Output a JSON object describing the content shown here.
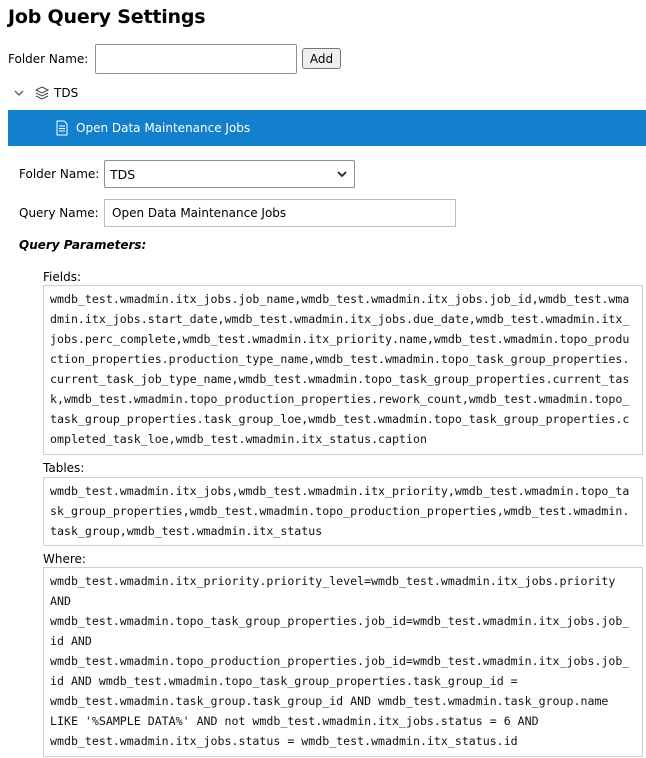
{
  "page": {
    "title": "Job Query Settings"
  },
  "add_folder": {
    "label": "Folder Name:",
    "value": "",
    "button_label": "Add"
  },
  "tree": {
    "folder_name": "TDS",
    "selected_item": "Open Data Maintenance Jobs"
  },
  "form": {
    "folder_label": "Folder Name:",
    "folder_value": "TDS",
    "query_name_label": "Query Name:",
    "query_name_value": "Open Data Maintenance Jobs",
    "params_heading": "Query Parameters:",
    "fields_label": "Fields:",
    "fields_value": "wmdb_test.wmadmin.itx_jobs.job_name,wmdb_test.wmadmin.itx_jobs.job_id,wmdb_test.wmadmin.itx_jobs.start_date,wmdb_test.wmadmin.itx_jobs.due_date,wmdb_test.wmadmin.itx_jobs.perc_complete,wmdb_test.wmadmin.itx_priority.name,wmdb_test.wmadmin.topo_production_properties.production_type_name,wmdb_test.wmadmin.topo_task_group_properties.current_task_job_type_name,wmdb_test.wmadmin.topo_task_group_properties.current_task,wmdb_test.wmadmin.topo_production_properties.rework_count,wmdb_test.wmadmin.topo_task_group_properties.task_group_loe,wmdb_test.wmadmin.topo_task_group_properties.completed_task_loe,wmdb_test.wmadmin.itx_status.caption",
    "tables_label": "Tables:",
    "tables_value": "wmdb_test.wmadmin.itx_jobs,wmdb_test.wmadmin.itx_priority,wmdb_test.wmadmin.topo_task_group_properties,wmdb_test.wmadmin.topo_production_properties,wmdb_test.wmadmin.task_group,wmdb_test.wmadmin.itx_status",
    "where_label": "Where:",
    "where_value": "wmdb_test.wmadmin.itx_priority.priority_level=wmdb_test.wmadmin.itx_jobs.priority\nAND\nwmdb_test.wmadmin.topo_task_group_properties.job_id=wmdb_test.wmadmin.itx_jobs.job_id AND\nwmdb_test.wmadmin.topo_production_properties.job_id=wmdb_test.wmadmin.itx_jobs.job_id AND wmdb_test.wmadmin.topo_task_group_properties.task_group_id =\nwmdb_test.wmadmin.task_group.task_group_id AND wmdb_test.wmadmin.task_group.name\nLIKE '%SAMPLE DATA%' AND not wmdb_test.wmadmin.itx_jobs.status = 6 AND\nwmdb_test.wmadmin.itx_jobs.status = wmdb_test.wmadmin.itx_status.id"
  },
  "colors": {
    "accent": "#1280cc",
    "accent_text": "#ffffff"
  },
  "icons": {
    "tree_toggle": "chevron-down-icon",
    "folder": "layers-icon",
    "query": "document-icon",
    "select": "chevron-down-icon"
  }
}
